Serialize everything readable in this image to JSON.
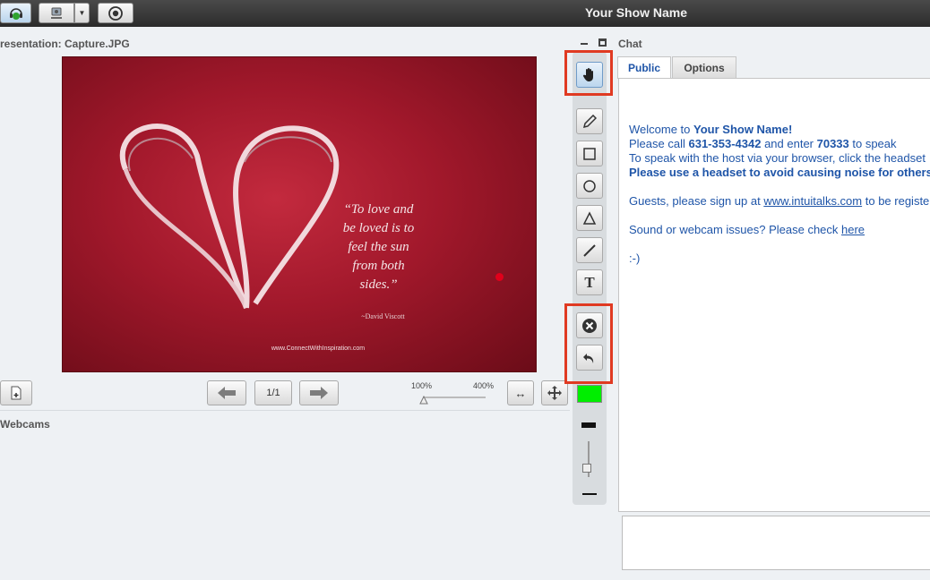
{
  "app": {
    "title": "Your Show Name"
  },
  "presentation": {
    "title": "resentation: Capture.JPG",
    "slide": {
      "quote": "“To love and be loved is to feel the sun from both sides.”",
      "author": "~David Viscott",
      "website": "www.ConnectWithInspiration.com"
    },
    "page_label": "1/1",
    "zoom_min": "100%",
    "zoom_max": "400%"
  },
  "webcams": {
    "title": "Webcams"
  },
  "chat": {
    "title": "Chat",
    "tabs": [
      "Public",
      "Options"
    ],
    "messages": {
      "welcome_prefix": "Welcome to ",
      "welcome_name": "Your Show Name!",
      "call_prefix": " Please call ",
      "phone": "631-353-4342",
      "call_mid": " and enter ",
      "code": "70333",
      "call_suffix": " to speak",
      "browser_line": "To speak with the host via your browser, click the headset",
      "headset_line": "Please use a headset to avoid causing noise for others",
      "guests_prefix": "Guests, please sign up at ",
      "guests_link": "www.intuitalks.com",
      "guests_suffix": " to be registered",
      "sound_prefix": "Sound or webcam issues? Please check ",
      "sound_link": "here",
      "smiley": ":-)"
    }
  },
  "colors": {
    "accent_red": "#e03a22",
    "drawing_color": "#00ee00",
    "chat_text": "#1f55a8"
  }
}
